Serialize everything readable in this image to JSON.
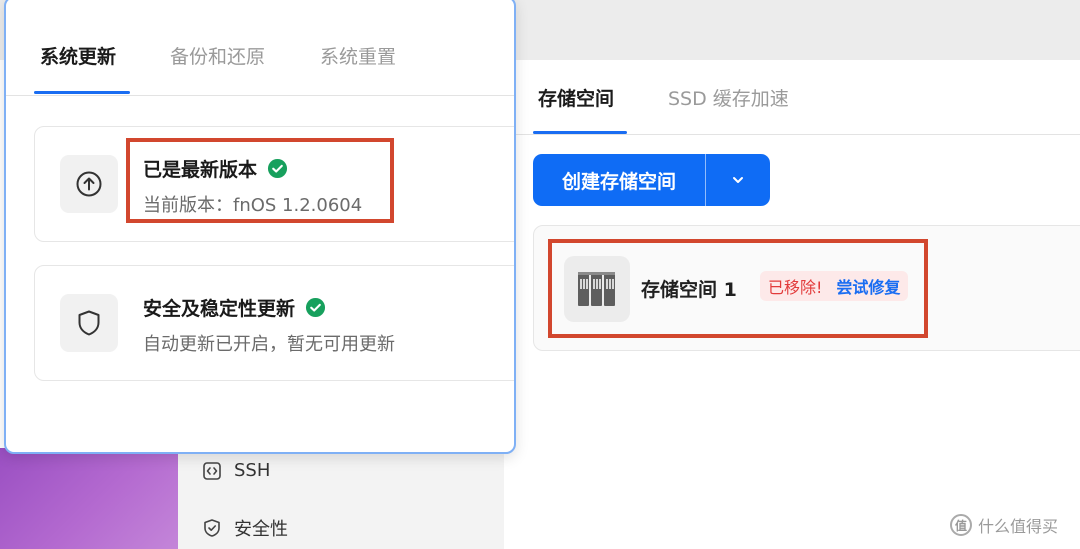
{
  "update_window": {
    "tabs": [
      {
        "label": "系统更新"
      },
      {
        "label": "备份和还原"
      },
      {
        "label": "系统重置"
      }
    ],
    "version_card": {
      "icon": "arrow-up-circle-icon",
      "title": "已是最新版本",
      "description": "当前版本：fnOS 1.2.0604"
    },
    "security_card": {
      "icon": "shield-icon",
      "title": "安全及稳定性更新",
      "description": "自动更新已开启，暂无可用更新"
    },
    "colors": {
      "accent": "#1a6df2",
      "success": "#17a05d",
      "annotation": "#d2472e"
    }
  },
  "storage_window": {
    "tabs": [
      {
        "label": "存储空间"
      },
      {
        "label": "SSD 缓存加速"
      }
    ],
    "create_button": {
      "label": "创建存储空间"
    },
    "pool": {
      "name": "存储空间 1",
      "status": "已移除!",
      "repair_link": "尝试修复",
      "icon": "disk-array-icon"
    },
    "colors": {
      "primary_button": "#0f6cf5",
      "error": "#e23b3b",
      "link": "#1a6df2"
    }
  },
  "sidebar": {
    "items": [
      {
        "label": "SSH",
        "icon": "code-bracket-icon"
      },
      {
        "label": "安全性",
        "icon": "shield-check-icon"
      }
    ]
  },
  "watermark": {
    "text": "什么值得买",
    "icon": "smzdm-logo-icon"
  }
}
